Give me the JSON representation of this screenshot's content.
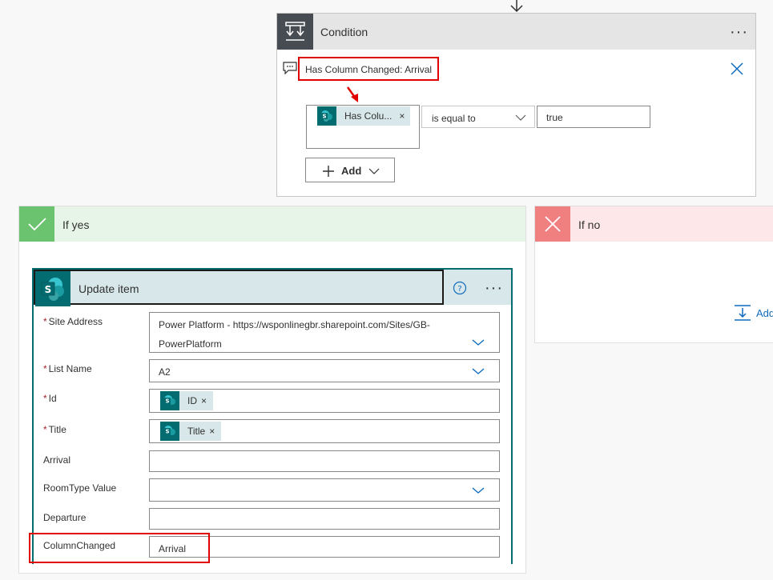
{
  "condition": {
    "title": "Condition",
    "comment": "Has Column Changed: Arrival",
    "left_token": "Has Colu...",
    "operator": "is equal to",
    "value": "true",
    "add_label": "Add"
  },
  "if_yes": {
    "title": "If yes"
  },
  "if_no": {
    "title": "If no",
    "add_label": "Add"
  },
  "update_item": {
    "title": "Update item",
    "fields": {
      "site_address": {
        "label": "Site Address",
        "value_line1": "Power Platform - https://wsponlinegbr.sharepoint.com/Sites/GB-",
        "value_line2": "PowerPlatform"
      },
      "list_name": {
        "label": "List Name",
        "value": "A2"
      },
      "id": {
        "label": "Id",
        "token": "ID"
      },
      "title": {
        "label": "Title",
        "token": "Title"
      },
      "arrival": {
        "label": "Arrival",
        "value": ""
      },
      "roomtype": {
        "label": "RoomType Value",
        "value": ""
      },
      "departure": {
        "label": "Departure",
        "value": ""
      },
      "column_changed": {
        "label": "ColumnChanged",
        "value": "Arrival"
      }
    }
  },
  "icons": {
    "condition": "condition-icon",
    "sharepoint": "sharepoint-icon",
    "checkmark": "checkmark-icon",
    "cross": "cross-icon",
    "help": "help-icon",
    "more": "more-options-icon",
    "close": "close-icon",
    "chevron": "chevron-down-icon",
    "comment": "comment-icon",
    "add": "add-action-icon",
    "flow_arrow": "flow-arrow-icon"
  },
  "colors": {
    "sharepoint": "#036c70",
    "yes": "#6cc36f",
    "no": "#f08080",
    "highlight": "#e00000",
    "link": "#0f6cbd"
  }
}
